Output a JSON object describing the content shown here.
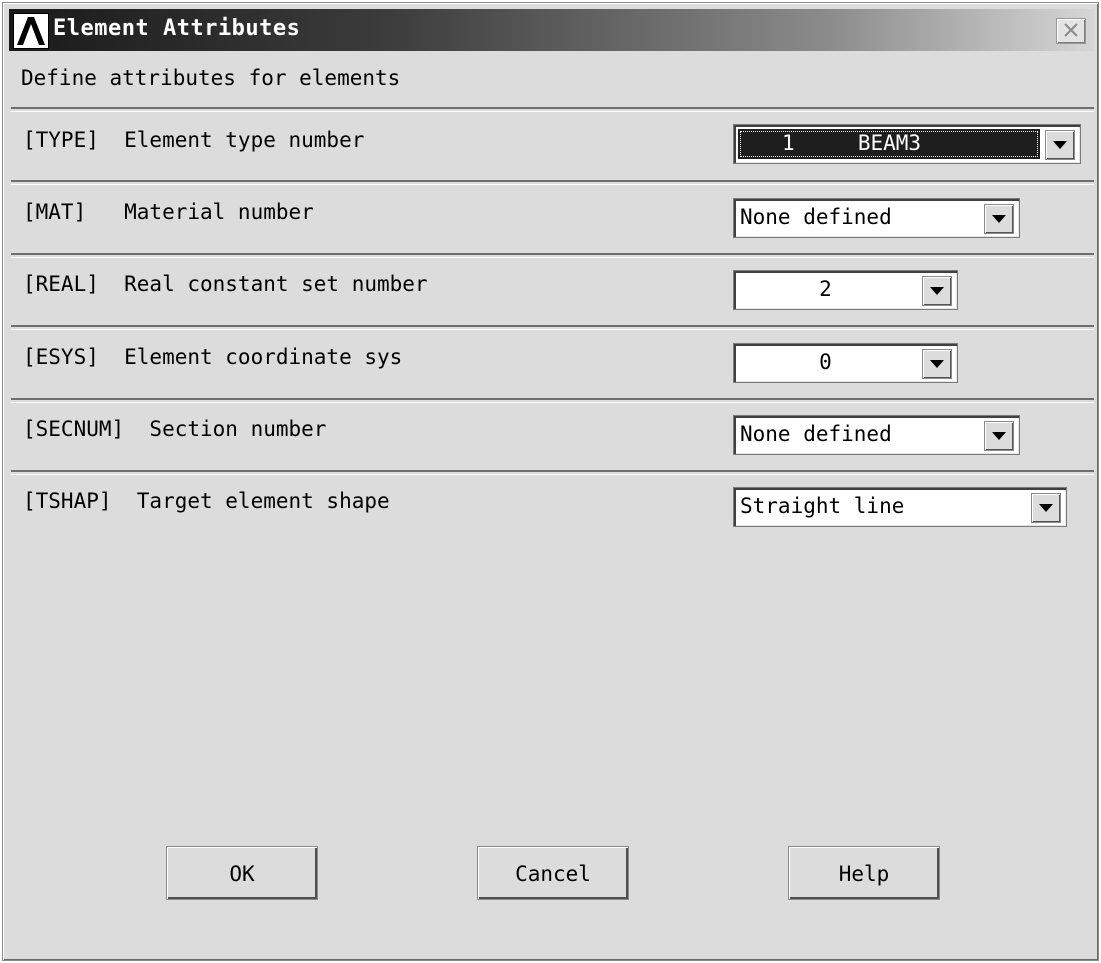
{
  "window": {
    "title": "Element Attributes",
    "close_icon": "close-icon",
    "logo_icon": "ansys-logo-icon"
  },
  "subtitle": "Define attributes for elements",
  "rows": [
    {
      "label": "[TYPE]  Element type number",
      "value": "1     BEAM3",
      "selected": true
    },
    {
      "label": "[MAT]   Material number",
      "value": "None defined"
    },
    {
      "label": "[REAL]  Real constant set number",
      "value": "2"
    },
    {
      "label": "[ESYS]  Element coordinate sys",
      "value": "0"
    },
    {
      "label": "[SECNUM]  Section number",
      "value": "None defined"
    },
    {
      "label": "[TSHAP]  Target element shape",
      "value": "Straight line"
    }
  ],
  "buttons": {
    "ok": "OK",
    "cancel": "Cancel",
    "help": "Help"
  },
  "colors": {
    "titlebar_start": "#1a1a1a",
    "titlebar_end": "#d6d6d6",
    "dialog_bg": "#dcdcdc"
  }
}
